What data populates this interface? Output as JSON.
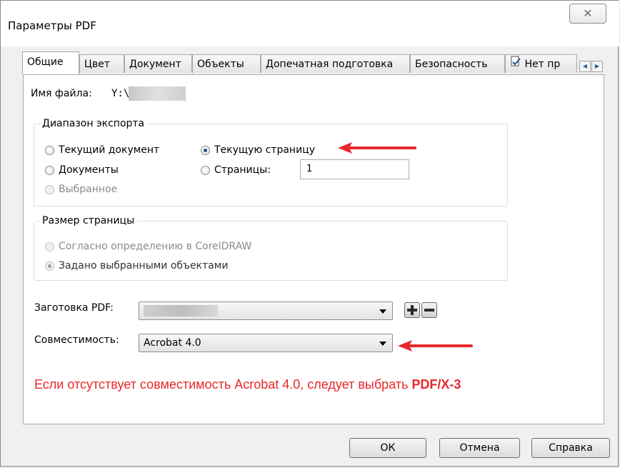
{
  "window": {
    "title": "Параметры PDF",
    "close_label": "✕"
  },
  "tabs": [
    "Общие",
    "Цвет",
    "Документ",
    "Объекты",
    "Допечатная подготовка",
    "Безопасность",
    "Нет пр"
  ],
  "file": {
    "label": "Имя файла:",
    "value": "Y:\\"
  },
  "export_range": {
    "legend": "Диапазон экспорта",
    "current_document": "Текущий документ",
    "current_page": "Текущую страницу",
    "documents": "Документы",
    "pages": "Страницы:",
    "pages_value": "1",
    "selected": "Выбранное",
    "selected_option": "current_page"
  },
  "page_size": {
    "legend": "Размер страницы",
    "as_defined": "Согласно определению в CorelDRAW",
    "by_selected": "Задано выбранными объектами"
  },
  "preset": {
    "label": "Заготовка PDF:",
    "value": ""
  },
  "compatibility": {
    "label": "Совместимость:",
    "value": "Acrobat 4.0"
  },
  "note": {
    "text": "Если отсутствует совместимость Acrobat 4.0, следует выбрать ",
    "highlight": "PDF/X-3",
    "color": "#e8282b"
  },
  "buttons": {
    "ok": "ОК",
    "cancel": "Отмена",
    "help": "Справка"
  },
  "colors": {
    "accent_red": "#e8282b",
    "radio_checked": "#1a4f9a"
  }
}
